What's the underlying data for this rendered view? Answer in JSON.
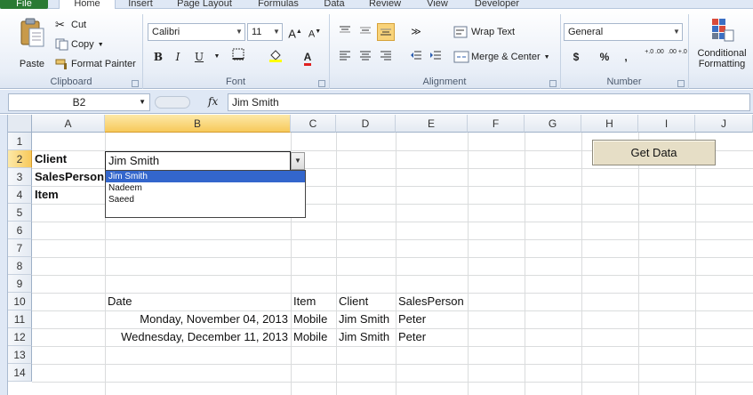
{
  "tabs": {
    "file": "File",
    "home": "Home",
    "insert": "Insert",
    "page_layout": "Page Layout",
    "formulas": "Formulas",
    "data": "Data",
    "review": "Review",
    "view": "View",
    "developer": "Developer"
  },
  "ribbon": {
    "clipboard": {
      "paste": "Paste",
      "cut": "Cut",
      "copy": "Copy",
      "format_painter": "Format Painter",
      "label": "Clipboard"
    },
    "font": {
      "name": "Calibri",
      "size": "11",
      "bold": "B",
      "italic": "I",
      "underline": "U",
      "label": "Font"
    },
    "alignment": {
      "wrap_text": "Wrap Text",
      "merge_center": "Merge & Center",
      "label": "Alignment"
    },
    "number": {
      "format": "General",
      "currency": "$",
      "percent": "%",
      "comma": ",",
      "inc_decimal": "+.0 .00",
      "dec_decimal": ".00 +.0",
      "label": "Number"
    },
    "styles": {
      "conditional_line1": "Conditional",
      "conditional_line2": "Formatting"
    }
  },
  "formula_bar": {
    "name_box": "B2",
    "fx": "fx",
    "content": "Jim Smith"
  },
  "columns": [
    "A",
    "B",
    "C",
    "D",
    "E",
    "F",
    "G",
    "H",
    "I",
    "J"
  ],
  "rows": [
    "1",
    "2",
    "3",
    "4",
    "5",
    "6",
    "7",
    "8",
    "9",
    "10",
    "11",
    "12",
    "13",
    "14"
  ],
  "cells": {
    "A2": "Client",
    "A3": "SalesPerson",
    "A4": "Item",
    "B2": "Jim Smith",
    "B10": "Date",
    "C10": "Item",
    "D10": "Client",
    "E10": "SalesPerson",
    "B11": "Monday, November 04, 2013",
    "C11": "Mobile",
    "D11": "Jim Smith",
    "E11": "Peter",
    "B12": "Wednesday, December 11, 2013",
    "C12": "Mobile",
    "D12": "Jim Smith",
    "E12": "Peter"
  },
  "dropdown": {
    "options": [
      "Jim Smith",
      "Nadeem",
      "Saeed"
    ],
    "highlighted": "Jim Smith"
  },
  "button": {
    "get_data": "Get Data"
  },
  "colors": {
    "file_tab": "#2a7a33",
    "selected_header": "#f7c95b",
    "dropdown_highlight": "#3366cc",
    "button_face": "#e6dec6"
  }
}
